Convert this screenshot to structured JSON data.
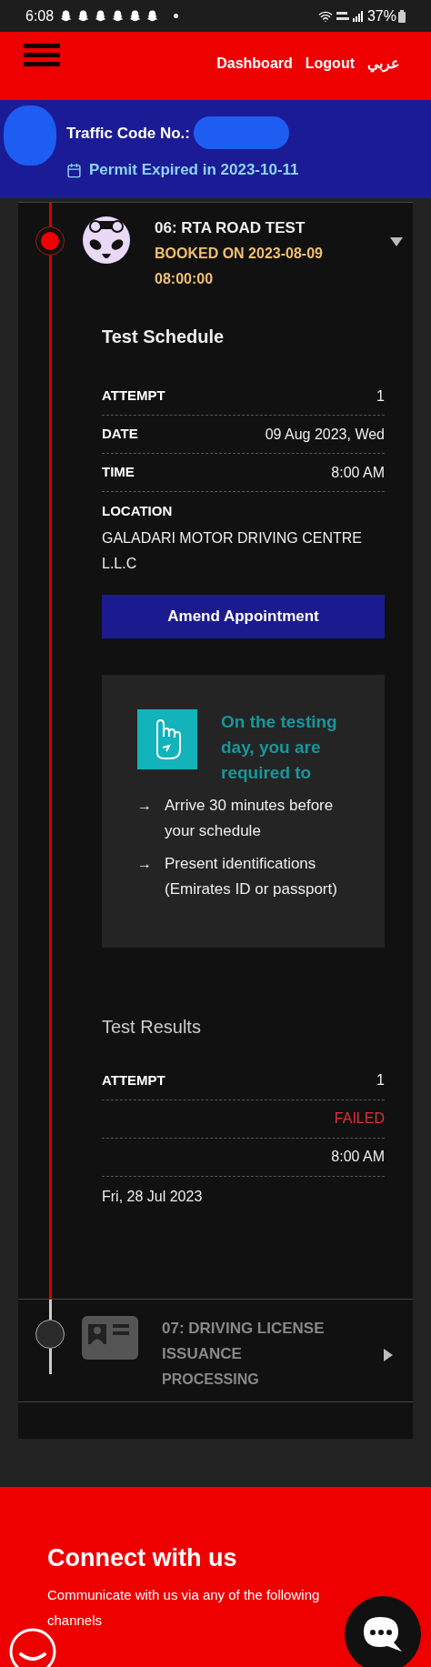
{
  "status_bar": {
    "time": "6:08",
    "notifications": [
      {
        "kind": "ghost"
      },
      {
        "kind": "ghost"
      },
      {
        "kind": "ghost"
      },
      {
        "kind": "ghost"
      },
      {
        "kind": "ghost"
      },
      {
        "kind": "ghost"
      }
    ],
    "battery": "37%"
  },
  "header": {
    "links": [
      {
        "label": "Dashboard"
      },
      {
        "label": "Logout"
      },
      {
        "label": "عربي"
      }
    ]
  },
  "profile": {
    "traffic_code_label": "Traffic Code No.:",
    "permit": "Permit Expired in 2023-10-11"
  },
  "steps": [
    {
      "kind": "road-test",
      "active": true,
      "expanded": true,
      "title": "06: RTA ROAD TEST",
      "subtitle": "BOOKED ON 2023-08-09 08:00:00"
    },
    {
      "kind": "license",
      "active": false,
      "expanded": false,
      "title": "07: DRIVING LICENSE ISSUANCE",
      "subtitle": "PROCESSING"
    }
  ],
  "schedule": {
    "title": "Test Schedule",
    "rows": [
      {
        "label": "ATTEMPT",
        "value": "1"
      },
      {
        "label": "DATE",
        "value": "09 Aug 2023, Wed"
      },
      {
        "label": "TIME",
        "value": "8:00 AM"
      }
    ],
    "location": {
      "label": "LOCATION",
      "value": "GALADARI MOTOR DRIVING CENTRE L.L.C"
    },
    "button": "Amend Appointment"
  },
  "notice": {
    "heading": "On the testing day, you are required to",
    "items": [
      {
        "arrow": "→",
        "text": "Arrive 30 minutes before your schedule"
      },
      {
        "arrow": "→",
        "text": "Present identifications (Emirates ID or passport)"
      }
    ]
  },
  "results": {
    "title": "Test Results",
    "rows": [
      {
        "kind": "labeled",
        "label": "ATTEMPT",
        "value": "1"
      },
      {
        "kind": "status",
        "value": "FAILED"
      },
      {
        "kind": "plain",
        "value": "8:00 AM"
      }
    ],
    "date": "Fri, 28 Jul 2023"
  },
  "footer": {
    "title": "Connect with us",
    "text": "Communicate with us via any of the following channels"
  }
}
